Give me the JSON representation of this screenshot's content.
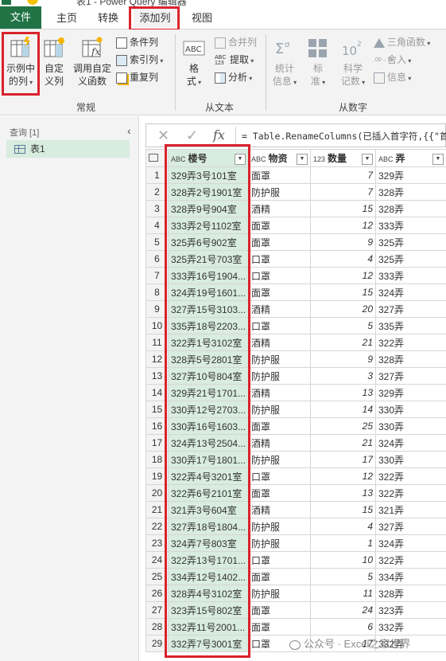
{
  "window": {
    "title": "表1 - Power Query 编辑器"
  },
  "tabs": [
    {
      "label": "文件"
    },
    {
      "label": "主页"
    },
    {
      "label": "转换"
    },
    {
      "label": "添加列"
    },
    {
      "label": "视图"
    }
  ],
  "ribbon": {
    "example_column": {
      "line1": "示例中",
      "line2": "的列"
    },
    "custom_column": {
      "line1": "自定",
      "line2": "义列"
    },
    "invoke_function": {
      "line1": "调用自定",
      "line2": "义函数"
    },
    "conditional_column": "条件列",
    "index_column": "索引列",
    "duplicate_column": "重复列",
    "format": {
      "line1": "格",
      "line2": "式"
    },
    "merge_columns": "合并列",
    "extract": "提取",
    "parse": "分析",
    "statistics": {
      "line1": "统计",
      "line2": "信息"
    },
    "standard": {
      "line1": "标",
      "line2": "准"
    },
    "scientific": {
      "line1": "科学",
      "line2": "记数"
    },
    "trigonometry": "三角函数",
    "rounding": "舍入",
    "information": "信息",
    "group_general": "常规",
    "group_from_text": "从文本",
    "group_from_number": "从数字",
    "abc_label": "ABC",
    "abc_digits": "123",
    "sci_base": "10",
    "sci_exp": "2",
    "decimals": ".00→.0"
  },
  "queries": {
    "header": "查询 [1]",
    "items": [
      {
        "label": "表1"
      }
    ]
  },
  "formula_bar": {
    "cancel": "✕",
    "confirm": "✓",
    "fx": "fx",
    "text": "= Table.RenameColumns(已插入首字符,{{\"首"
  },
  "grid": {
    "columns": [
      {
        "type": "ABC",
        "name": "楼号"
      },
      {
        "type": "ABC",
        "name": "物资"
      },
      {
        "type": "123",
        "name": "数量"
      },
      {
        "type": "ABC",
        "name": "弄"
      }
    ],
    "rows": [
      [
        "1",
        "329弄3号101室",
        "面罩",
        "7",
        "329弄"
      ],
      [
        "2",
        "328弄2号1901室",
        "防护服",
        "7",
        "328弄"
      ],
      [
        "3",
        "328弄9号904室",
        "酒精",
        "15",
        "328弄"
      ],
      [
        "4",
        "333弄2号1102室",
        "面罩",
        "12",
        "333弄"
      ],
      [
        "5",
        "325弄6号902室",
        "面罩",
        "9",
        "325弄"
      ],
      [
        "6",
        "325弄21号703室",
        "口罩",
        "4",
        "325弄"
      ],
      [
        "7",
        "333弄16号1904...",
        "口罩",
        "12",
        "333弄"
      ],
      [
        "8",
        "324弄19号1601...",
        "面罩",
        "15",
        "324弄"
      ],
      [
        "9",
        "327弄15号3103...",
        "酒精",
        "20",
        "327弄"
      ],
      [
        "10",
        "335弄18号2203...",
        "口罩",
        "5",
        "335弄"
      ],
      [
        "11",
        "322弄1号3102室",
        "酒精",
        "21",
        "322弄"
      ],
      [
        "12",
        "328弄5号2801室",
        "防护服",
        "9",
        "328弄"
      ],
      [
        "13",
        "327弄10号804室",
        "防护服",
        "3",
        "327弄"
      ],
      [
        "14",
        "329弄21号1701...",
        "酒精",
        "13",
        "329弄"
      ],
      [
        "15",
        "330弄12号2703...",
        "防护服",
        "14",
        "330弄"
      ],
      [
        "16",
        "330弄16号1603...",
        "面罩",
        "25",
        "330弄"
      ],
      [
        "17",
        "324弄13号2504...",
        "酒精",
        "21",
        "324弄"
      ],
      [
        "18",
        "330弄17号1801...",
        "防护服",
        "17",
        "330弄"
      ],
      [
        "19",
        "322弄4号3201室",
        "口罩",
        "12",
        "322弄"
      ],
      [
        "20",
        "322弄6号2101室",
        "面罩",
        "13",
        "322弄"
      ],
      [
        "21",
        "321弄3号604室",
        "酒精",
        "15",
        "321弄"
      ],
      [
        "22",
        "327弄18号1804...",
        "防护服",
        "4",
        "327弄"
      ],
      [
        "23",
        "324弄7号803室",
        "防护服",
        "1",
        "324弄"
      ],
      [
        "24",
        "322弄13号1701...",
        "口罩",
        "10",
        "322弄"
      ],
      [
        "25",
        "334弄12号1402...",
        "面罩",
        "5",
        "334弄"
      ],
      [
        "26",
        "328弄4号3102室",
        "防护服",
        "11",
        "328弄"
      ],
      [
        "27",
        "323弄15号802室",
        "面罩",
        "24",
        "323弄"
      ],
      [
        "28",
        "332弄11号2001...",
        "面罩",
        "6",
        "332弄"
      ],
      [
        "29",
        "332弄7号3001室",
        "口罩",
        "17",
        "332弄"
      ]
    ]
  },
  "watermark": "公众号 · Excel之家世界",
  "colors": {
    "file_tab": "#217346",
    "highlight": "#d9232d",
    "selected_column": "#d8ecdf"
  }
}
